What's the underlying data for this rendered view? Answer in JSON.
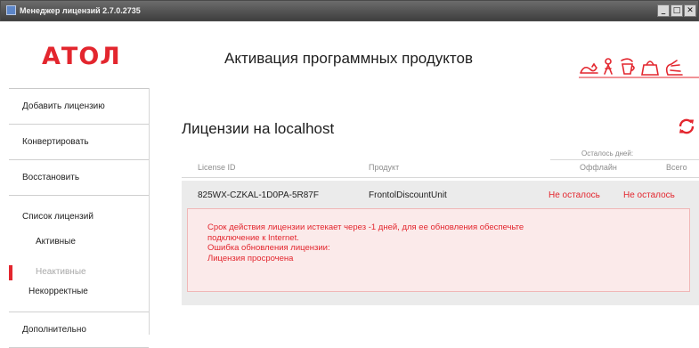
{
  "window": {
    "title": "Менеджер лицензий 2.7.0.2735",
    "controls": [
      "_",
      "□",
      "✕"
    ]
  },
  "header": {
    "logo": "АТОЛ",
    "title": "Активация программных продуктов",
    "icons": [
      "cat-icon",
      "man-icon",
      "coffee-icon",
      "bag-icon",
      "hand-icon"
    ]
  },
  "sidebar": {
    "add": "Добавить лицензию",
    "convert": "Конвертировать",
    "restore": "Восстановить",
    "list_title": "Список лицензий",
    "active": "Активные",
    "inactive": "Неактивные",
    "incorrect": "Некорректные",
    "more": "Дополнительно"
  },
  "main": {
    "title": "Лицензии на localhost",
    "days_left_label": "Осталось дней:",
    "columns": [
      "License ID",
      "Продукт",
      "Оффлайн",
      "Всего"
    ],
    "license": {
      "id": "825WX-CZKAL-1D0PA-5R87F",
      "product": "FrontolDiscountUnit",
      "offline": "Не осталось",
      "total": "Не осталось",
      "error_lines": [
        "Срок действия лицензии истекает через -1 дней, для ее обновления обеспечьте",
        "подключение к Internet.",
        "Ошибка обновления лицензии:",
        "Лицензия просрочена"
      ]
    }
  },
  "colors": {
    "accent": "#e3262e",
    "row_bg": "#ebebeb",
    "error_bg": "#fbeaea"
  }
}
